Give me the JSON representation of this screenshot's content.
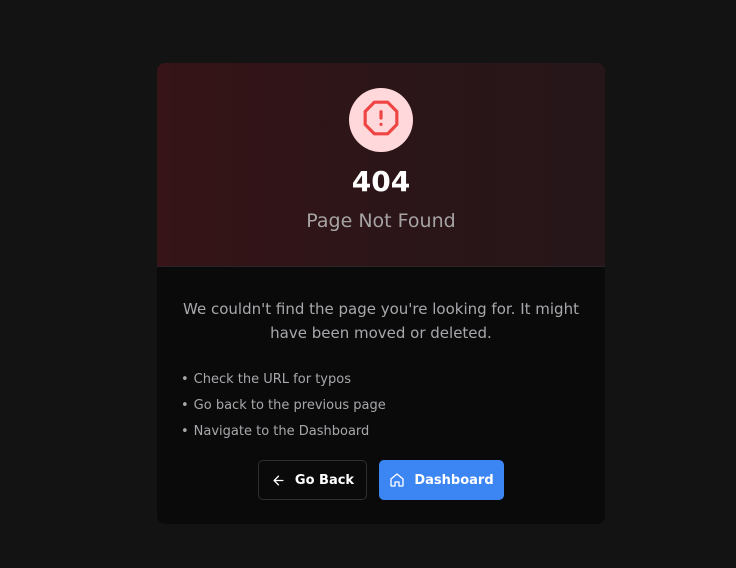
{
  "error": {
    "code": "404",
    "title": "Page Not Found",
    "icon": "alert-octagon-icon",
    "accent_color": "#ef4444"
  },
  "message": "We couldn't find the page you're looking for. It might have been moved or deleted.",
  "tips": [
    "Check the URL for typos",
    "Go back to the previous page",
    "Navigate to the Dashboard"
  ],
  "actions": {
    "back_label": "Go Back",
    "back_icon": "arrow-left-icon",
    "dashboard_label": "Dashboard",
    "dashboard_icon": "home-icon",
    "dashboard_color": "#3c86f4"
  }
}
